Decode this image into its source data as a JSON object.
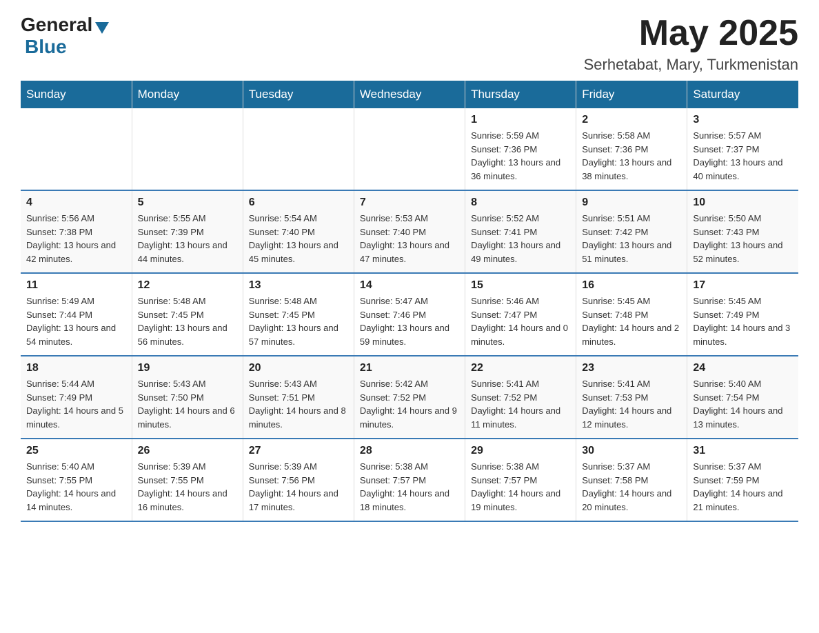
{
  "header": {
    "logo_general": "General",
    "logo_blue": "Blue",
    "month_year": "May 2025",
    "location": "Serhetabat, Mary, Turkmenistan"
  },
  "weekdays": [
    "Sunday",
    "Monday",
    "Tuesday",
    "Wednesday",
    "Thursday",
    "Friday",
    "Saturday"
  ],
  "weeks": [
    [
      {
        "day": "",
        "info": ""
      },
      {
        "day": "",
        "info": ""
      },
      {
        "day": "",
        "info": ""
      },
      {
        "day": "",
        "info": ""
      },
      {
        "day": "1",
        "info": "Sunrise: 5:59 AM\nSunset: 7:36 PM\nDaylight: 13 hours and 36 minutes."
      },
      {
        "day": "2",
        "info": "Sunrise: 5:58 AM\nSunset: 7:36 PM\nDaylight: 13 hours and 38 minutes."
      },
      {
        "day": "3",
        "info": "Sunrise: 5:57 AM\nSunset: 7:37 PM\nDaylight: 13 hours and 40 minutes."
      }
    ],
    [
      {
        "day": "4",
        "info": "Sunrise: 5:56 AM\nSunset: 7:38 PM\nDaylight: 13 hours and 42 minutes."
      },
      {
        "day": "5",
        "info": "Sunrise: 5:55 AM\nSunset: 7:39 PM\nDaylight: 13 hours and 44 minutes."
      },
      {
        "day": "6",
        "info": "Sunrise: 5:54 AM\nSunset: 7:40 PM\nDaylight: 13 hours and 45 minutes."
      },
      {
        "day": "7",
        "info": "Sunrise: 5:53 AM\nSunset: 7:40 PM\nDaylight: 13 hours and 47 minutes."
      },
      {
        "day": "8",
        "info": "Sunrise: 5:52 AM\nSunset: 7:41 PM\nDaylight: 13 hours and 49 minutes."
      },
      {
        "day": "9",
        "info": "Sunrise: 5:51 AM\nSunset: 7:42 PM\nDaylight: 13 hours and 51 minutes."
      },
      {
        "day": "10",
        "info": "Sunrise: 5:50 AM\nSunset: 7:43 PM\nDaylight: 13 hours and 52 minutes."
      }
    ],
    [
      {
        "day": "11",
        "info": "Sunrise: 5:49 AM\nSunset: 7:44 PM\nDaylight: 13 hours and 54 minutes."
      },
      {
        "day": "12",
        "info": "Sunrise: 5:48 AM\nSunset: 7:45 PM\nDaylight: 13 hours and 56 minutes."
      },
      {
        "day": "13",
        "info": "Sunrise: 5:48 AM\nSunset: 7:45 PM\nDaylight: 13 hours and 57 minutes."
      },
      {
        "day": "14",
        "info": "Sunrise: 5:47 AM\nSunset: 7:46 PM\nDaylight: 13 hours and 59 minutes."
      },
      {
        "day": "15",
        "info": "Sunrise: 5:46 AM\nSunset: 7:47 PM\nDaylight: 14 hours and 0 minutes."
      },
      {
        "day": "16",
        "info": "Sunrise: 5:45 AM\nSunset: 7:48 PM\nDaylight: 14 hours and 2 minutes."
      },
      {
        "day": "17",
        "info": "Sunrise: 5:45 AM\nSunset: 7:49 PM\nDaylight: 14 hours and 3 minutes."
      }
    ],
    [
      {
        "day": "18",
        "info": "Sunrise: 5:44 AM\nSunset: 7:49 PM\nDaylight: 14 hours and 5 minutes."
      },
      {
        "day": "19",
        "info": "Sunrise: 5:43 AM\nSunset: 7:50 PM\nDaylight: 14 hours and 6 minutes."
      },
      {
        "day": "20",
        "info": "Sunrise: 5:43 AM\nSunset: 7:51 PM\nDaylight: 14 hours and 8 minutes."
      },
      {
        "day": "21",
        "info": "Sunrise: 5:42 AM\nSunset: 7:52 PM\nDaylight: 14 hours and 9 minutes."
      },
      {
        "day": "22",
        "info": "Sunrise: 5:41 AM\nSunset: 7:52 PM\nDaylight: 14 hours and 11 minutes."
      },
      {
        "day": "23",
        "info": "Sunrise: 5:41 AM\nSunset: 7:53 PM\nDaylight: 14 hours and 12 minutes."
      },
      {
        "day": "24",
        "info": "Sunrise: 5:40 AM\nSunset: 7:54 PM\nDaylight: 14 hours and 13 minutes."
      }
    ],
    [
      {
        "day": "25",
        "info": "Sunrise: 5:40 AM\nSunset: 7:55 PM\nDaylight: 14 hours and 14 minutes."
      },
      {
        "day": "26",
        "info": "Sunrise: 5:39 AM\nSunset: 7:55 PM\nDaylight: 14 hours and 16 minutes."
      },
      {
        "day": "27",
        "info": "Sunrise: 5:39 AM\nSunset: 7:56 PM\nDaylight: 14 hours and 17 minutes."
      },
      {
        "day": "28",
        "info": "Sunrise: 5:38 AM\nSunset: 7:57 PM\nDaylight: 14 hours and 18 minutes."
      },
      {
        "day": "29",
        "info": "Sunrise: 5:38 AM\nSunset: 7:57 PM\nDaylight: 14 hours and 19 minutes."
      },
      {
        "day": "30",
        "info": "Sunrise: 5:37 AM\nSunset: 7:58 PM\nDaylight: 14 hours and 20 minutes."
      },
      {
        "day": "31",
        "info": "Sunrise: 5:37 AM\nSunset: 7:59 PM\nDaylight: 14 hours and 21 minutes."
      }
    ]
  ]
}
